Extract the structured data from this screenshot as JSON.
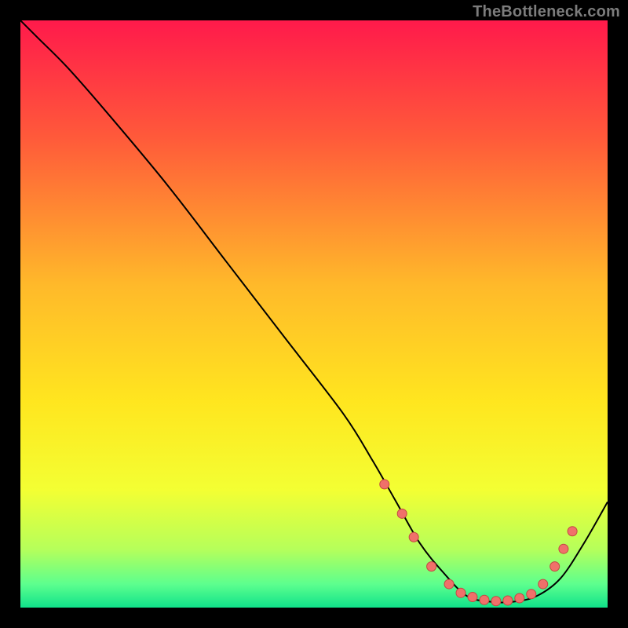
{
  "attribution": "TheBottleneck.com",
  "chart_data": {
    "type": "line",
    "title": "",
    "xlabel": "",
    "ylabel": "",
    "xlim": [
      0,
      100
    ],
    "ylim": [
      0,
      100
    ],
    "grid": false,
    "legend": false,
    "background": {
      "type": "vertical-gradient",
      "stops": [
        {
          "offset": 0,
          "color": "#ff1a4b"
        },
        {
          "offset": 20,
          "color": "#ff5a3a"
        },
        {
          "offset": 45,
          "color": "#ffb92a"
        },
        {
          "offset": 65,
          "color": "#ffe61f"
        },
        {
          "offset": 80,
          "color": "#f3ff33"
        },
        {
          "offset": 90,
          "color": "#b6ff5a"
        },
        {
          "offset": 96,
          "color": "#5dff8e"
        },
        {
          "offset": 100,
          "color": "#10e28a"
        }
      ]
    },
    "series": [
      {
        "name": "bottleneck-curve",
        "stroke": "#000000",
        "stroke_width": 2,
        "x": [
          0,
          3,
          8,
          15,
          25,
          35,
          45,
          55,
          60,
          64,
          68,
          72,
          76,
          80,
          84,
          88,
          92,
          96,
          100
        ],
        "y": [
          100,
          97,
          92,
          84,
          72,
          59,
          46,
          33,
          25,
          18,
          11,
          6,
          2,
          1,
          1,
          2,
          5,
          11,
          18
        ]
      }
    ],
    "scatter": {
      "name": "markers",
      "fill": "#f0706a",
      "stroke": "#c24942",
      "radius": 6,
      "points": [
        {
          "x": 62,
          "y": 21
        },
        {
          "x": 65,
          "y": 16
        },
        {
          "x": 67,
          "y": 12
        },
        {
          "x": 70,
          "y": 7
        },
        {
          "x": 73,
          "y": 4
        },
        {
          "x": 75,
          "y": 2.5
        },
        {
          "x": 77,
          "y": 1.8
        },
        {
          "x": 79,
          "y": 1.3
        },
        {
          "x": 81,
          "y": 1.1
        },
        {
          "x": 83,
          "y": 1.2
        },
        {
          "x": 85,
          "y": 1.6
        },
        {
          "x": 87,
          "y": 2.3
        },
        {
          "x": 89,
          "y": 4
        },
        {
          "x": 91,
          "y": 7
        },
        {
          "x": 92.5,
          "y": 10
        },
        {
          "x": 94,
          "y": 13
        }
      ]
    }
  }
}
